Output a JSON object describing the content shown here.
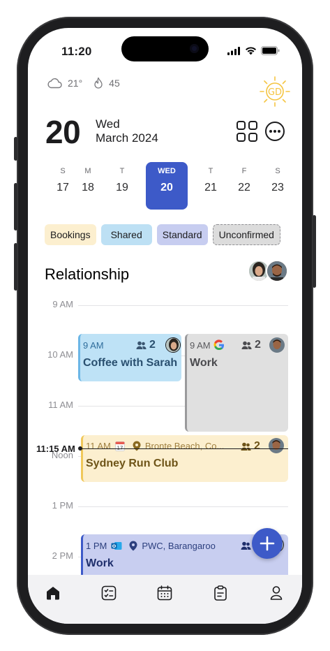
{
  "status": {
    "time": "11:20"
  },
  "weather": {
    "temperature": "21°",
    "condition_icon": "cloud-icon",
    "fire_count": "45"
  },
  "brand": {
    "logo_text": "GD"
  },
  "header": {
    "day_number": "20",
    "weekday": "Wed",
    "month_year": "March 2024"
  },
  "week": [
    {
      "label": "S",
      "num": "17"
    },
    {
      "label": "M",
      "num": "18"
    },
    {
      "label": "T",
      "num": "19"
    },
    {
      "label": "WED",
      "num": "20",
      "selected": true
    },
    {
      "label": "T",
      "num": "21"
    },
    {
      "label": "F",
      "num": "22"
    },
    {
      "label": "S",
      "num": "23"
    }
  ],
  "filters": [
    "Bookings",
    "Shared",
    "Standard",
    "Unconfirmed"
  ],
  "section": {
    "title": "Relationship"
  },
  "timeline": {
    "labels": [
      "9 AM",
      "10 AM",
      "11 AM",
      "Noon",
      "1 PM",
      "2 PM"
    ],
    "now_label": "11:15 AM"
  },
  "events": {
    "coffee": {
      "time": "9 AM",
      "attendees": "2",
      "title": "Coffee with Sarah",
      "color": "#bee2f6"
    },
    "work1": {
      "time": "9 AM",
      "source_icon": "google-icon",
      "attendees": "2",
      "title": "Work",
      "color": "#e0e0e0"
    },
    "run": {
      "time": "11 AM",
      "source_icon": "calendar-icon",
      "location": "Bronte Beach, Co...",
      "attendees": "2",
      "title": "Sydney Run Club",
      "color": "#fcefcf"
    },
    "pwc": {
      "time": "1 PM",
      "source_icon": "outlook-icon",
      "location": "PWC, Barangaroo",
      "attendees": "2",
      "title": "Work",
      "color": "#c8cef0"
    }
  },
  "colors": {
    "accent": "#3d5ac8"
  },
  "tabbar": [
    "home-icon",
    "tasks-icon",
    "calendar-icon",
    "clipboard-icon",
    "profile-icon"
  ]
}
